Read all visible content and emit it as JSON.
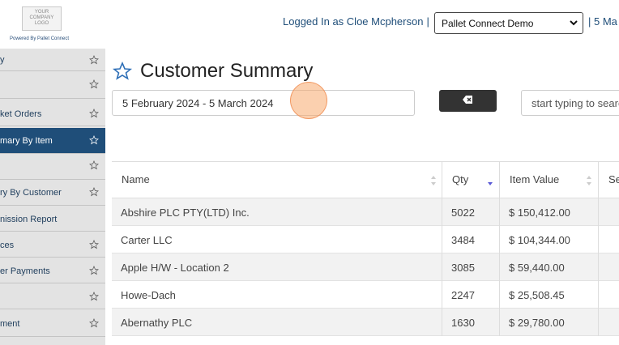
{
  "header": {
    "logo_lines": [
      "YOUR",
      "COMPANY",
      "LOGO"
    ],
    "powered_by": "Powered By Pallet Connect",
    "logged_in": "Logged In as Cloe Mcpherson",
    "separator": "|",
    "company_select": "Pallet Connect Demo",
    "date_partial": "| 5 Ma"
  },
  "sidebar": {
    "items": [
      {
        "label": "y",
        "star": true,
        "active": false
      },
      {
        "label": "",
        "star": true,
        "active": false
      },
      {
        "label": "ket Orders",
        "star": true,
        "active": false
      },
      {
        "label": "mary By Item",
        "star": true,
        "active": true
      },
      {
        "label": "",
        "star": true,
        "active": false
      },
      {
        "label": "ry By Customer",
        "star": true,
        "active": false
      },
      {
        "label": "nission Report",
        "star": false,
        "active": false
      },
      {
        "label": "ces",
        "star": true,
        "active": false
      },
      {
        "label": "er Payments",
        "star": true,
        "active": false
      },
      {
        "label": "",
        "star": true,
        "active": false
      },
      {
        "label": "ment",
        "star": true,
        "active": false
      }
    ]
  },
  "main": {
    "title": "Customer Summary",
    "date_range": "5 February 2024 - 5 March 2024",
    "search_placeholder": "start typing to search"
  },
  "table": {
    "columns": [
      "Name",
      "Qty",
      "Item Value",
      "Se"
    ],
    "rows": [
      [
        "Abshire PLC PTY(LTD) Inc.",
        "5022",
        "$ 150,412.00"
      ],
      [
        "Carter LLC",
        "3484",
        "$ 104,344.00"
      ],
      [
        "Apple H/W - Location 2",
        "3085",
        "$ 59,440.00"
      ],
      [
        "Howe-Dach",
        "2247",
        "$ 25,508.45"
      ],
      [
        "Abernathy PLC",
        "1630",
        "$ 29,780.00"
      ]
    ]
  },
  "colors": {
    "accent": "#1f4e79",
    "sidebar_bg": "#e3e3e3",
    "button_dark": "#333333"
  }
}
